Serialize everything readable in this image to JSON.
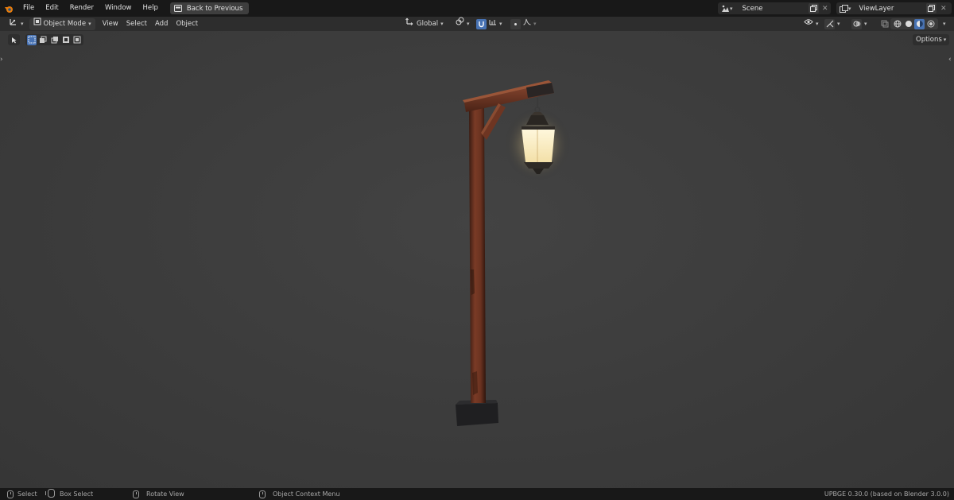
{
  "menubar": {
    "items": [
      "File",
      "Edit",
      "Render",
      "Window",
      "Help"
    ],
    "back_button": "Back to Previous",
    "scene_value": "Scene",
    "viewlayer_value": "ViewLayer"
  },
  "header": {
    "mode": "Object Mode",
    "menus": [
      "View",
      "Select",
      "Add",
      "Object"
    ],
    "orientation": "Global",
    "options_label": "Options"
  },
  "statusbar": {
    "select": "Select",
    "box_select": "Box Select",
    "rotate_view": "Rotate View",
    "context_menu": "Object Context Menu",
    "version": "UPBGE 0.30.0 (based on Blender 3.0.0)"
  },
  "colors": {
    "accent": "#4772b3",
    "viewport_bg": "#3d3d3d",
    "lamp_glow": "#fff1c8",
    "wood": "#6b3422"
  }
}
